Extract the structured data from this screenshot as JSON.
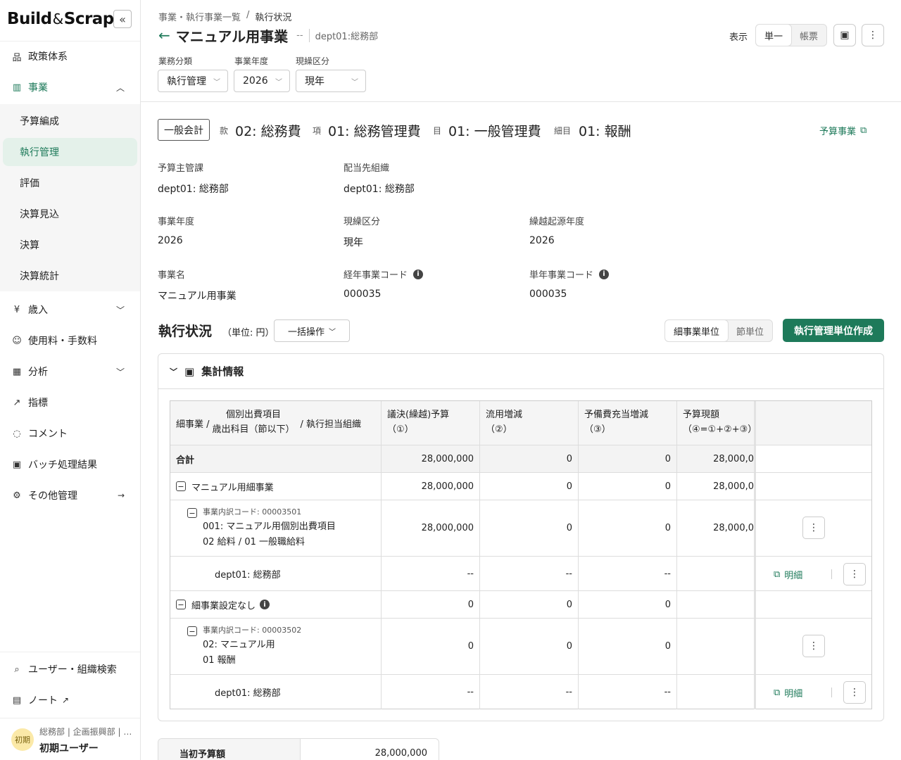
{
  "sidebar": {
    "logo_left": "Build",
    "logo_amp": "&",
    "logo_right": "Scrap",
    "collapse": "«",
    "items": [
      {
        "label": "政策体系",
        "icon": "hierarchy-icon"
      },
      {
        "label": "事業",
        "icon": "bar-chart-icon"
      },
      {
        "label": "歳入",
        "icon": "yen-receipt-icon"
      },
      {
        "label": "使用料・手数料",
        "icon": "users-fee-icon"
      },
      {
        "label": "分析",
        "icon": "analysis-icon"
      },
      {
        "label": "指標",
        "icon": "trend-icon"
      },
      {
        "label": "コメント",
        "icon": "comment-icon"
      },
      {
        "label": "バッチ処理結果",
        "icon": "terminal-icon"
      },
      {
        "label": "その他管理",
        "icon": "gear-icon"
      }
    ],
    "sub_items": [
      "予算編成",
      "執行管理",
      "評価",
      "決算見込",
      "決算",
      "決算統計"
    ],
    "bottom": [
      {
        "label": "ユーザー・組織検索",
        "icon": "search-icon"
      },
      {
        "label": "ノート",
        "icon": "book-icon"
      }
    ],
    "user": {
      "avatar": "初期",
      "org": "総務部 | 企画振興部 | …",
      "name": "初期ユーザー"
    }
  },
  "header": {
    "breadcrumb": [
      "事業・執行事業一覧",
      "/",
      "執行状況"
    ],
    "title": "マニュアル用事業",
    "title_sep": "--",
    "title_org": "dept01:総務部",
    "display_label": "表示",
    "view_modes": [
      "単一",
      "帳票"
    ],
    "filters": [
      {
        "label": "業務分類",
        "value": "執行管理"
      },
      {
        "label": "事業年度",
        "value": "2026"
      },
      {
        "label": "現繰区分",
        "value": "現年"
      }
    ]
  },
  "account": {
    "kaikei": "一般会計",
    "kan_label": "款",
    "kan": "02: 総務費",
    "kou_label": "項",
    "kou": "01: 総務管理費",
    "moku_label": "目",
    "moku": "01: 一般管理費",
    "saimoku_label": "細目",
    "saimoku": "01: 報酬",
    "budget_link": "予算事業"
  },
  "fields": {
    "yosan_shukan_label": "予算主管課",
    "yosan_shukan": "dept01: 総務部",
    "haito_label": "配当先組織",
    "haito": "dept01: 総務部",
    "year_label": "事業年度",
    "year": "2026",
    "genkuri_label": "現繰区分",
    "genkuri": "現年",
    "kurikoshi_label": "繰越起源年度",
    "kurikoshi": "2026",
    "name_label": "事業名",
    "name": "マニュアル用事業",
    "keinen_label": "経年事業コード",
    "keinen": "000035",
    "tannen_label": "単年事業コード",
    "tannen": "000035"
  },
  "status": {
    "title": "執行状況",
    "unit": "（単位: 円）",
    "bulk": "一括操作",
    "unit_modes": [
      "細事業単位",
      "節単位"
    ],
    "create_btn": "執行管理単位作成",
    "panel_title": "集計情報"
  },
  "table": {
    "headers": {
      "col1_a": "細事業 /",
      "col1_b": "個別出費項目",
      "col1_c": "歳出科目（節以下）",
      "col1_d": "/ 執行担当組織",
      "col2_a": "議決(繰越)予算",
      "col2_b": "（①）",
      "col3_a": "流用増減",
      "col3_b": "（②）",
      "col4_a": "予備費充当増減",
      "col4_b": "（③）",
      "col5_a": "予算現額",
      "col5_b": "（④=①+②+③）"
    },
    "total": {
      "label": "合計",
      "v1": "28,000,000",
      "v2": "0",
      "v3": "0",
      "v4": "28,000,0"
    },
    "group1": {
      "label": "マニュアル用細事業",
      "v1": "28,000,000",
      "v2": "0",
      "v3": "0",
      "v4": "28,000,0"
    },
    "item1": {
      "code": "事業内訳コード: 00003501",
      "name": "001: マニュアル用個別出費項目",
      "sub": "02 給料 / 01 一般職給料",
      "v1": "28,000,000",
      "v2": "0",
      "v3": "0",
      "v4": "28,000,0"
    },
    "org1": {
      "label": "dept01: 総務部",
      "v1": "--",
      "v2": "--",
      "v3": "--",
      "link": "明細"
    },
    "group2": {
      "label": "細事業設定なし",
      "v1": "0",
      "v2": "0",
      "v3": "0"
    },
    "item2": {
      "code": "事業内訳コード: 00003502",
      "name": "02: マニュアル用",
      "sub": "01 報酬",
      "v1": "0",
      "v2": "0",
      "v3": "0"
    },
    "org2": {
      "label": "dept01: 総務部",
      "v1": "--",
      "v2": "--",
      "v3": "--",
      "link": "明細"
    }
  },
  "summary": {
    "label": "当初予算額",
    "value": "28,000,000"
  }
}
